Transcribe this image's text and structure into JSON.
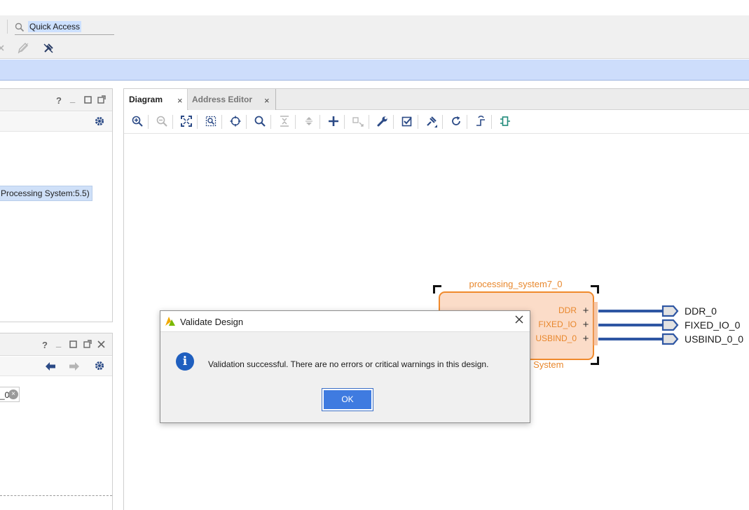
{
  "toolbar": {
    "quick_access": "Quick Access"
  },
  "left_panel_top": {
    "selected_item": "Processing System:5.5)",
    "header_icons": [
      "help-icon",
      "minimize-icon",
      "maximize-icon",
      "float-icon"
    ],
    "tool_icons": [
      "gear-icon"
    ]
  },
  "left_panel_bottom": {
    "field_value": "_0",
    "header_icons": [
      "help-icon",
      "minimize-icon",
      "maximize-icon",
      "float-icon",
      "close-icon"
    ],
    "tool_icons": [
      "back-arrow-icon",
      "forward-arrow-icon",
      "gear-icon"
    ]
  },
  "diagram": {
    "tabs": [
      {
        "label": "Diagram",
        "active": true
      },
      {
        "label": "Address Editor",
        "active": false
      }
    ],
    "toolbar_icons": [
      "zoom-in",
      "zoom-out",
      "zoom-fit",
      "zoom-area",
      "center",
      "search",
      "collapse-all",
      "expand-all",
      "add-ip",
      "add-module",
      "properties",
      "validate",
      "pin",
      "regenerate",
      "optimize-routing",
      "fit-ports"
    ],
    "ip_block": {
      "instance_name": "processing_system7_0",
      "subtitle": "ng System",
      "ports": [
        "DDR",
        "FIXED_IO",
        "USBIND_0"
      ]
    },
    "external_ports": [
      "DDR_0",
      "FIXED_IO_0",
      "USBIND_0_0"
    ]
  },
  "dialog": {
    "title": "Validate Design",
    "message": "Validation successful. There are no errors or critical warnings in this design.",
    "ok_label": "OK",
    "icon": "info-icon"
  },
  "colors": {
    "accent": "#2e56a3",
    "ip_orange": "#e8872c",
    "ip_fill": "#fbdcc8",
    "info_bar": "#cdddfb"
  }
}
